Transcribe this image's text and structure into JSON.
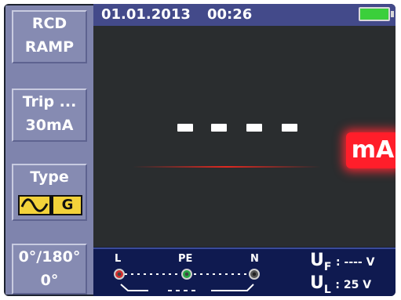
{
  "sidebar": {
    "mode": {
      "line1": "RCD",
      "line2": "RAMP"
    },
    "trip": {
      "line1": "Trip ...",
      "line2": "30mA"
    },
    "type": {
      "label": "Type",
      "type_letter": "G"
    },
    "phase": {
      "line1": "0°/180°",
      "line2": "0°"
    }
  },
  "header": {
    "date": "01.01.2013",
    "time": "00:26",
    "battery_icon": "battery-full-icon",
    "battery_level_fraction": 1.0
  },
  "display": {
    "unit": "mA"
  },
  "terminals": {
    "L": "L",
    "PE": "PE",
    "N": "N"
  },
  "readings": {
    "uf_letter": "U",
    "uf_sub": "F",
    "uf_rest": ": ---- V",
    "ul_letter": "U",
    "ul_sub": "L",
    "ul_rest": ": 25 V"
  },
  "colors": {
    "sidebar": "#7f84ad",
    "header": "#434a8a",
    "screen": "#2a2d2f",
    "footer": "#0f1a50",
    "unit_badge": "#ff1e2a",
    "type_box": "#f3d23a",
    "battery": "#3bcf3b",
    "term_L": "#d32f2f",
    "term_PE": "#27a844",
    "term_N": "#555555"
  }
}
